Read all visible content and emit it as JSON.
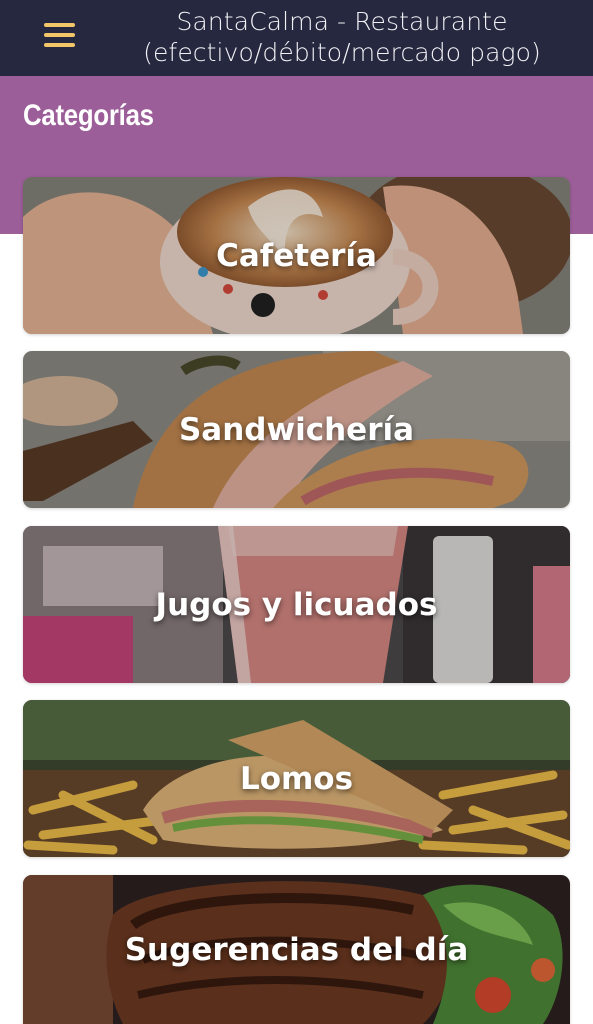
{
  "header": {
    "title_line1": "SantaCalma - Restaurante",
    "title_line2": "(efectivo/débito/mercado pago)",
    "menu_icon": "hamburger-menu-icon",
    "background": "#262840",
    "menu_icon_color": "#f4c66a"
  },
  "page": {
    "section_title": "Categorías",
    "band_color": "#9b5e98"
  },
  "categories": [
    {
      "label": "Cafetería",
      "image": "latte-art-cup-photo"
    },
    {
      "label": "Sandwichería",
      "image": "ham-sandwich-photo"
    },
    {
      "label": "Jugos y licuados",
      "image": "smoothie-glass-photo"
    },
    {
      "label": "Lomos",
      "image": "lomo-sandwich-fries-photo"
    },
    {
      "label": "Sugerencias del día",
      "image": "grilled-steak-salad-photo"
    }
  ]
}
